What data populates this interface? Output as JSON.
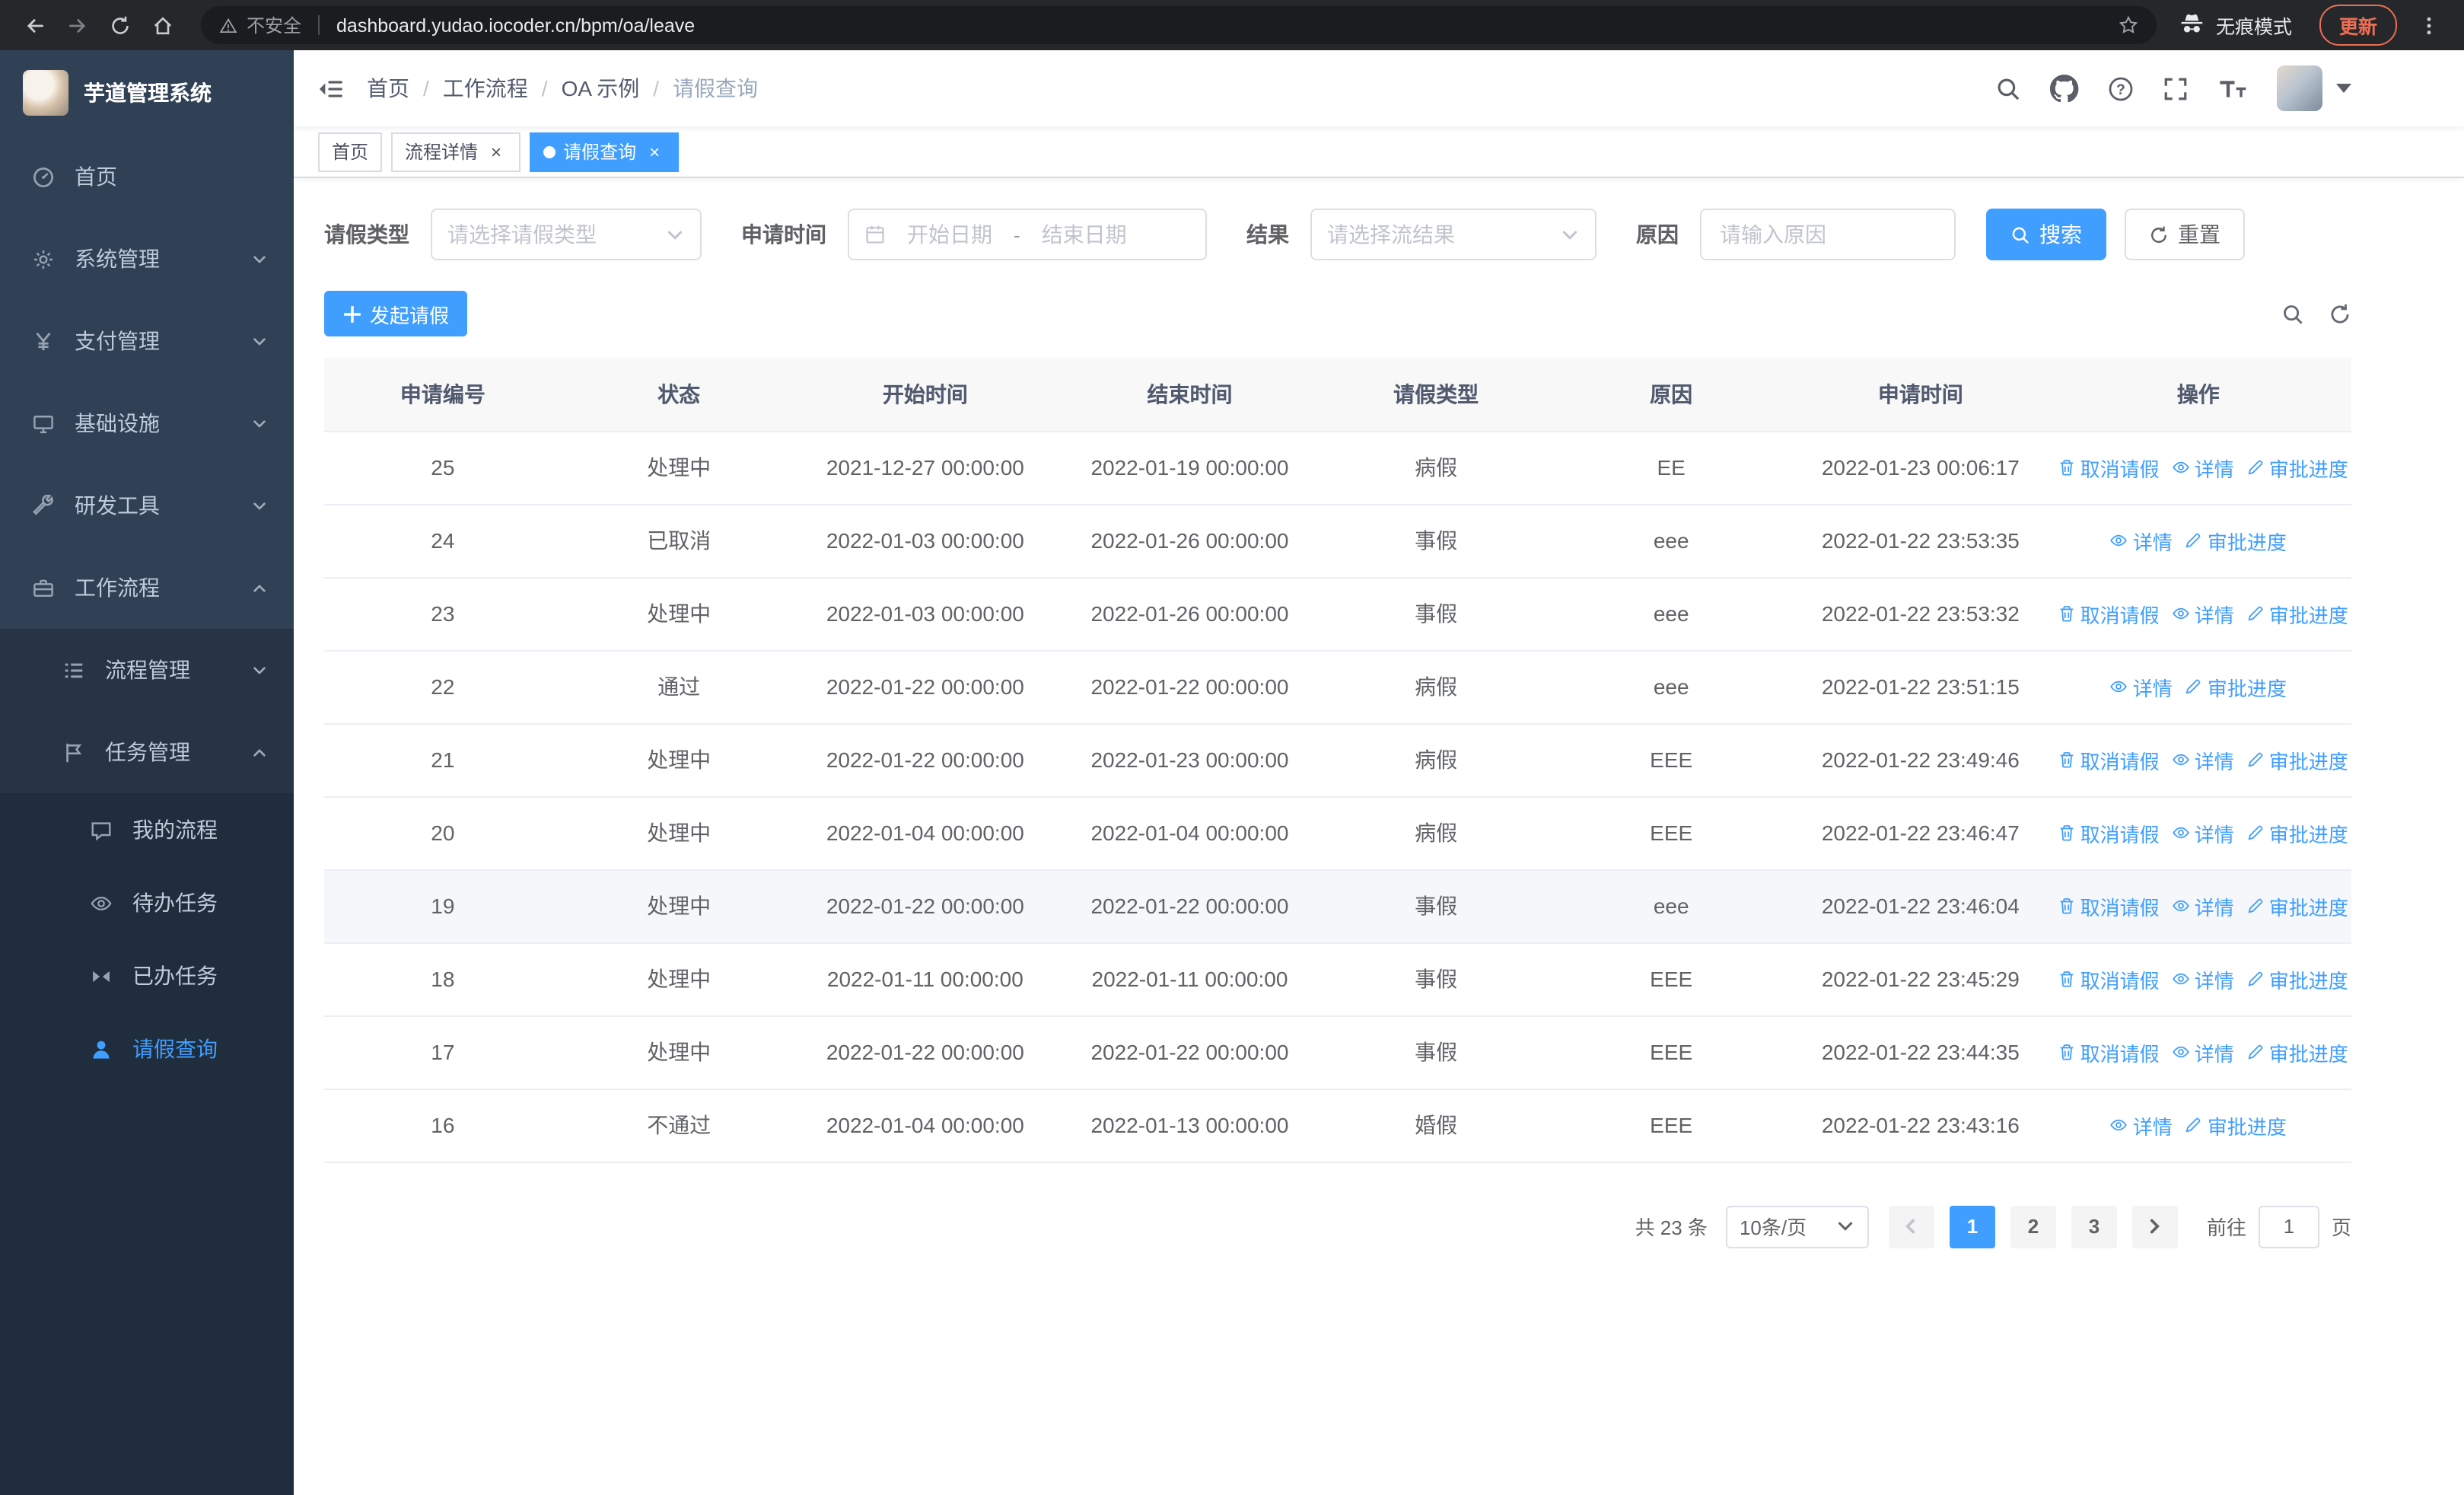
{
  "colors": {
    "primary": "#409eff",
    "sidebar_bg": "#304156",
    "sidebar_submenu_bg": "#1f2d3d",
    "sidebar_text": "#bfcbd9",
    "tab_active_bg": "#409eff"
  },
  "browser": {
    "security_chip": "不安全",
    "url": "dashboard.yudao.iocoder.cn/bpm/oa/leave",
    "incognito_label": "无痕模式",
    "update_button": "更新"
  },
  "sidebar": {
    "app_title": "芋道管理系统",
    "menu": [
      {
        "label": "首页",
        "icon": "dashboard-icon",
        "level": 1
      },
      {
        "label": "系统管理",
        "icon": "gear-icon",
        "level": 1,
        "arrow": "down"
      },
      {
        "label": "支付管理",
        "icon": "payment-icon",
        "level": 1,
        "arrow": "down"
      },
      {
        "label": "基础设施",
        "icon": "infrastructure-icon",
        "level": 1,
        "arrow": "down"
      },
      {
        "label": "研发工具",
        "icon": "devtools-icon",
        "level": 1,
        "arrow": "down"
      },
      {
        "label": "工作流程",
        "icon": "workflow-icon",
        "level": 1,
        "arrow": "up"
      },
      {
        "label": "流程管理",
        "icon": "process-list-icon",
        "level": 2,
        "arrow": "down"
      },
      {
        "label": "任务管理",
        "icon": "task-flag-icon",
        "level": 2,
        "arrow": "up"
      },
      {
        "label": "我的流程",
        "icon": "chat-bubble-icon",
        "level": 3
      },
      {
        "label": "待办任务",
        "icon": "eye-icon",
        "level": 3
      },
      {
        "label": "已办任务",
        "icon": "done-tasks-icon",
        "level": 3
      },
      {
        "label": "请假查询",
        "icon": "user-icon",
        "level": 3,
        "active": true
      }
    ]
  },
  "navbar": {
    "breadcrumb": [
      "首页",
      "工作流程",
      "OA 示例",
      "请假查询"
    ]
  },
  "tags": [
    {
      "label": "首页",
      "active": false,
      "closable": false
    },
    {
      "label": "流程详情",
      "active": false,
      "closable": true
    },
    {
      "label": "请假查询",
      "active": true,
      "closable": true
    }
  ],
  "filters": {
    "leave_type_label": "请假类型",
    "leave_type_placeholder": "请选择请假类型",
    "apply_time_label": "申请时间",
    "start_date_placeholder": "开始日期",
    "range_separator": "-",
    "end_date_placeholder": "结束日期",
    "result_label": "结果",
    "result_placeholder": "请选择流结果",
    "reason_label": "原因",
    "reason_placeholder": "请输入原因",
    "search_button": "搜索",
    "reset_button": "重置"
  },
  "toolbar": {
    "create_button": "发起请假"
  },
  "table": {
    "headers": [
      "申请编号",
      "状态",
      "开始时间",
      "结束时间",
      "请假类型",
      "原因",
      "申请时间",
      "操作"
    ],
    "action_labels": {
      "cancel": "取消请假",
      "detail": "详情",
      "progress": "审批进度"
    },
    "action_icons": {
      "cancel": "delete-icon",
      "detail": "view-icon",
      "progress": "edit-icon"
    },
    "rows": [
      {
        "id": "25",
        "status": "处理中",
        "start_time": "2021-12-27 00:00:00",
        "end_time": "2022-01-19 00:00:00",
        "leave_type": "病假",
        "reason": "EE",
        "apply_time": "2022-01-23 00:06:17",
        "actions": [
          "cancel",
          "detail",
          "progress"
        ]
      },
      {
        "id": "24",
        "status": "已取消",
        "start_time": "2022-01-03 00:00:00",
        "end_time": "2022-01-26 00:00:00",
        "leave_type": "事假",
        "reason": "eee",
        "apply_time": "2022-01-22 23:53:35",
        "actions": [
          "detail",
          "progress"
        ]
      },
      {
        "id": "23",
        "status": "处理中",
        "start_time": "2022-01-03 00:00:00",
        "end_time": "2022-01-26 00:00:00",
        "leave_type": "事假",
        "reason": "eee",
        "apply_time": "2022-01-22 23:53:32",
        "actions": [
          "cancel",
          "detail",
          "progress"
        ]
      },
      {
        "id": "22",
        "status": "通过",
        "start_time": "2022-01-22 00:00:00",
        "end_time": "2022-01-22 00:00:00",
        "leave_type": "病假",
        "reason": "eee",
        "apply_time": "2022-01-22 23:51:15",
        "actions": [
          "detail",
          "progress"
        ]
      },
      {
        "id": "21",
        "status": "处理中",
        "start_time": "2022-01-22 00:00:00",
        "end_time": "2022-01-23 00:00:00",
        "leave_type": "病假",
        "reason": "EEE",
        "apply_time": "2022-01-22 23:49:46",
        "actions": [
          "cancel",
          "detail",
          "progress"
        ]
      },
      {
        "id": "20",
        "status": "处理中",
        "start_time": "2022-01-04 00:00:00",
        "end_time": "2022-01-04 00:00:00",
        "leave_type": "病假",
        "reason": "EEE",
        "apply_time": "2022-01-22 23:46:47",
        "actions": [
          "cancel",
          "detail",
          "progress"
        ]
      },
      {
        "id": "19",
        "status": "处理中",
        "start_time": "2022-01-22 00:00:00",
        "end_time": "2022-01-22 00:00:00",
        "leave_type": "事假",
        "reason": "eee",
        "apply_time": "2022-01-22 23:46:04",
        "actions": [
          "cancel",
          "detail",
          "progress"
        ],
        "highlighted": true
      },
      {
        "id": "18",
        "status": "处理中",
        "start_time": "2022-01-11 00:00:00",
        "end_time": "2022-01-11 00:00:00",
        "leave_type": "事假",
        "reason": "EEE",
        "apply_time": "2022-01-22 23:45:29",
        "actions": [
          "cancel",
          "detail",
          "progress"
        ]
      },
      {
        "id": "17",
        "status": "处理中",
        "start_time": "2022-01-22 00:00:00",
        "end_time": "2022-01-22 00:00:00",
        "leave_type": "事假",
        "reason": "EEE",
        "apply_time": "2022-01-22 23:44:35",
        "actions": [
          "cancel",
          "detail",
          "progress"
        ]
      },
      {
        "id": "16",
        "status": "不通过",
        "start_time": "2022-01-04 00:00:00",
        "end_time": "2022-01-13 00:00:00",
        "leave_type": "婚假",
        "reason": "EEE",
        "apply_time": "2022-01-22 23:43:16",
        "actions": [
          "detail",
          "progress"
        ]
      }
    ]
  },
  "pagination": {
    "total_text": "共 23 条",
    "page_size": "10条/页",
    "pages": [
      "1",
      "2",
      "3"
    ],
    "current_page": "1",
    "goto_label": "前往",
    "goto_value": "1",
    "goto_unit": "页"
  }
}
